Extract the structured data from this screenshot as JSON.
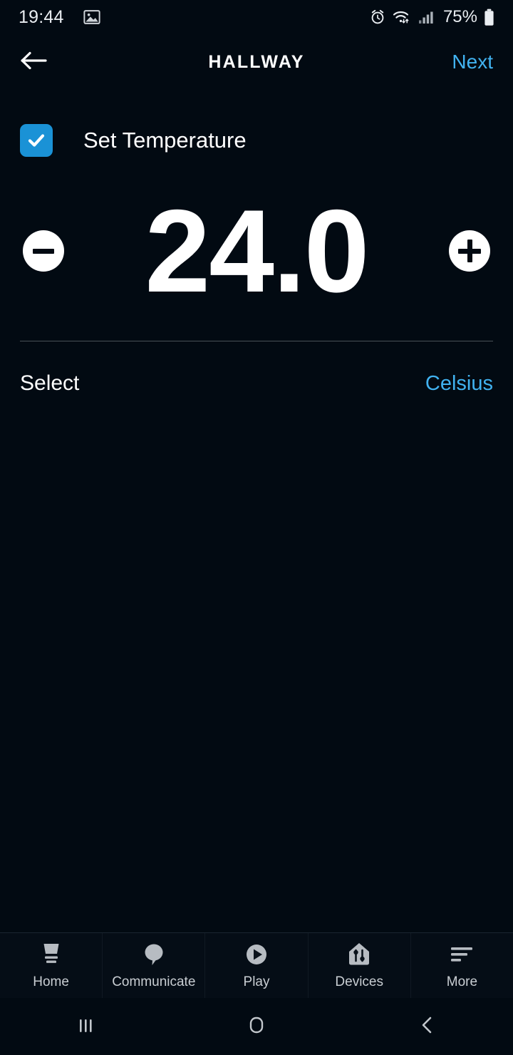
{
  "status_bar": {
    "time": "19:44",
    "battery_percent": "75%",
    "icons": [
      "image-icon",
      "alarm-icon",
      "wifi-icon",
      "cellular-signal-icon",
      "battery-icon"
    ]
  },
  "header": {
    "back_icon": "back-arrow-icon",
    "title": "HALLWAY",
    "next_label": "Next",
    "accent_color": "#41b2f0"
  },
  "main": {
    "set_temperature": {
      "label": "Set Temperature",
      "checked": true,
      "checkbox_color": "#1a92d6"
    },
    "stepper": {
      "decrease_icon": "minus-icon",
      "increase_icon": "plus-icon",
      "value": "24.0"
    },
    "unit_row": {
      "label": "Select",
      "value": "Celsius"
    }
  },
  "tab_bar": {
    "tabs": [
      {
        "label": "Home",
        "icon": "echo-device-icon"
      },
      {
        "label": "Communicate",
        "icon": "speech-bubble-icon"
      },
      {
        "label": "Play",
        "icon": "play-circle-icon"
      },
      {
        "label": "Devices",
        "icon": "house-sliders-icon"
      },
      {
        "label": "More",
        "icon": "hamburger-menu-icon"
      }
    ]
  },
  "android_nav": {
    "recents_icon": "recent-apps-icon",
    "home_icon": "home-circle-icon",
    "back_icon": "chevron-left-icon"
  }
}
